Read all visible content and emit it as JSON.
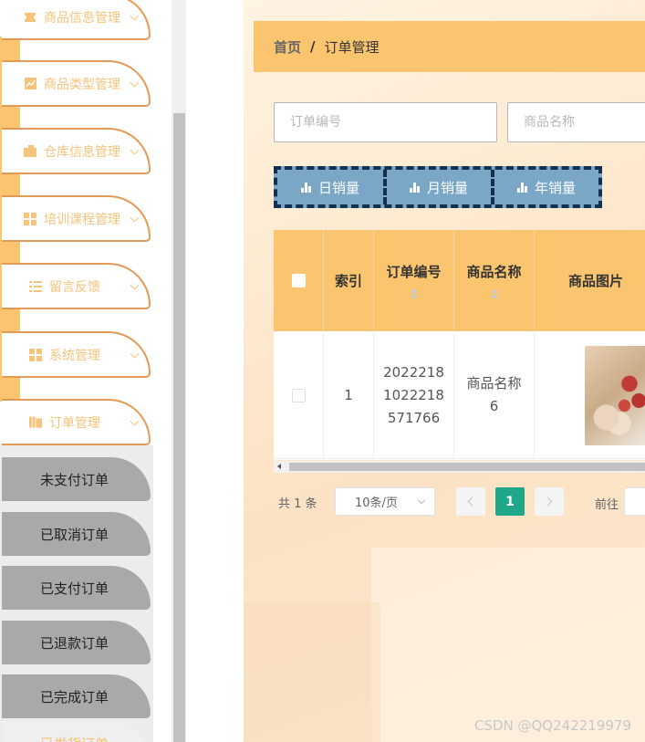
{
  "sidebar": {
    "menu": [
      {
        "label": "商品信息管理",
        "icon": "ticket-icon"
      },
      {
        "label": "商品类型管理",
        "icon": "chart-icon"
      },
      {
        "label": "仓库信息管理",
        "icon": "briefcase-icon"
      },
      {
        "label": "培训课程管理",
        "icon": "grid-icon"
      },
      {
        "label": "留言反馈",
        "icon": "list-icon"
      },
      {
        "label": "系统管理",
        "icon": "grid-icon"
      },
      {
        "label": "订单管理",
        "icon": "book-icon"
      }
    ],
    "submenu": [
      "未支付订单",
      "已取消订单",
      "已支付订单",
      "已退款订单",
      "已完成订单",
      "已发货订单"
    ]
  },
  "breadcrumb": {
    "home": "首页",
    "separator": "/",
    "current": "订单管理"
  },
  "search": {
    "order_no_placeholder": "订单编号",
    "product_name_placeholder": "商品名称"
  },
  "stats_buttons": {
    "daily": "日销量",
    "monthly": "月销量",
    "yearly": "年销量"
  },
  "table": {
    "headers": {
      "index": "索引",
      "order_no": "订单编号",
      "product_name": "商品名称",
      "product_image": "商品图片"
    },
    "rows": [
      {
        "index": "1",
        "order_no": "2022218 1022218 571766",
        "product_name": "商品名称6"
      }
    ]
  },
  "pagination": {
    "total_text": "共 1 条",
    "page_size": "10条/页",
    "current_page": "1",
    "goto_label": "前往"
  },
  "watermark": "CSDN @QQ242219979",
  "colors": {
    "accent": "#fbc56f",
    "menu_border": "#e39a56",
    "menu_text": "#f6c37a",
    "stats_button_bg": "#7aa7c6",
    "page_active": "#1ea889",
    "submenu_bg": "#a9a9a9"
  }
}
